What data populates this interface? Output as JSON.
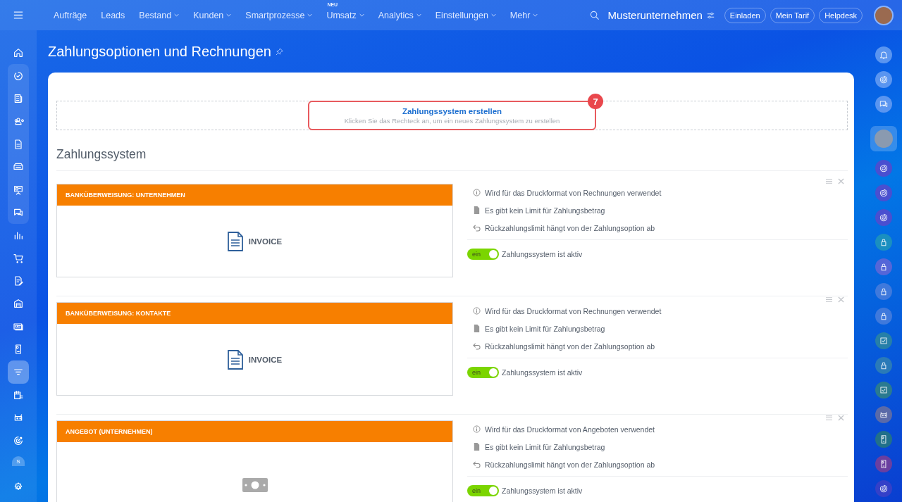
{
  "topnav": {
    "items": [
      {
        "label": "Aufträge",
        "dropdown": false
      },
      {
        "label": "Leads",
        "dropdown": false
      },
      {
        "label": "Bestand",
        "dropdown": true
      },
      {
        "label": "Kunden",
        "dropdown": true
      },
      {
        "label": "Smartprozesse",
        "dropdown": true
      },
      {
        "label": "Umsatz",
        "dropdown": true,
        "badge": "NEU"
      },
      {
        "label": "Analytics",
        "dropdown": true
      },
      {
        "label": "Einstellungen",
        "dropdown": true
      },
      {
        "label": "Mehr",
        "dropdown": true
      }
    ],
    "company": "Musterunternehmen",
    "buttons": [
      "Einladen",
      "Mein Tarif",
      "Helpdesk"
    ]
  },
  "sidebar": {
    "items": [
      {
        "kind": "home",
        "selected": false,
        "grouped": false
      },
      {
        "kind": "tasks",
        "selected": false,
        "grouped": true
      },
      {
        "kind": "news",
        "selected": false,
        "grouped": true
      },
      {
        "kind": "contacts",
        "selected": false,
        "grouped": true
      },
      {
        "kind": "doc",
        "selected": false,
        "grouped": true
      },
      {
        "kind": "inbox",
        "selected": false,
        "grouped": true
      },
      {
        "kind": "board",
        "selected": false,
        "grouped": true
      },
      {
        "kind": "chat",
        "selected": false,
        "grouped": true
      },
      {
        "kind": "chart",
        "selected": false,
        "grouped": false
      },
      {
        "kind": "cart",
        "selected": false,
        "grouped": false
      },
      {
        "kind": "sign",
        "selected": false,
        "grouped": false
      },
      {
        "kind": "store",
        "selected": false,
        "grouped": false
      },
      {
        "kind": "card",
        "selected": false,
        "grouped": false
      },
      {
        "kind": "phone",
        "selected": false,
        "grouped": false
      },
      {
        "kind": "funnel",
        "selected": true,
        "grouped": false
      },
      {
        "kind": "calendar",
        "selected": false,
        "grouped": false
      },
      {
        "kind": "robot",
        "selected": false,
        "grouped": false
      },
      {
        "kind": "target",
        "selected": false,
        "grouped": false
      }
    ],
    "user_initial": "S"
  },
  "page": {
    "title": "Zahlungsoptionen und Rechnungen"
  },
  "create_box": {
    "title": "Zahlungssystem erstellen",
    "hint": "Klicken Sie das Rechteck an, um ein neues Zahlungssystem zu erstellen",
    "marker": "7"
  },
  "section_title": "Zahlungssystem",
  "payment_systems": [
    {
      "title": "BANKÜBERWEISUNG: UNTERNEHMEN",
      "kind": "invoice",
      "logo_label": "INVOICE",
      "info": [
        {
          "kind": "info",
          "text": "Wird für das Druckformat von Rechnungen verwendet"
        },
        {
          "kind": "file",
          "text": "Es gibt kein Limit für Zahlungsbetrag"
        },
        {
          "kind": "refund",
          "text": "Rückzahlungslimit hängt von der Zahlungsoption ab"
        }
      ],
      "switch_label": "ein",
      "on": true,
      "status": "Zahlungssystem ist aktiv"
    },
    {
      "title": "BANKÜBERWEISUNG: KONTAKTE",
      "kind": "invoice",
      "logo_label": "INVOICE",
      "info": [
        {
          "kind": "info",
          "text": "Wird für das Druckformat von Rechnungen verwendet"
        },
        {
          "kind": "file",
          "text": "Es gibt kein Limit für Zahlungsbetrag"
        },
        {
          "kind": "refund",
          "text": "Rückzahlungslimit hängt von der Zahlungsoption ab"
        }
      ],
      "switch_label": "ein",
      "on": true,
      "status": "Zahlungssystem ist aktiv"
    },
    {
      "title": "ANGEBOT (UNTERNEHMEN)",
      "kind": "cash",
      "info": [
        {
          "kind": "info",
          "text": "Wird für das Druckformat von Angeboten verwendet"
        },
        {
          "kind": "file",
          "text": "Es gibt kein Limit für Zahlungsbetrag"
        },
        {
          "kind": "refund",
          "text": "Rückzahlungslimit hängt von der Zahlungsoption ab"
        }
      ],
      "switch_label": "ein",
      "on": true,
      "status": "Zahlungssystem ist aktiv"
    }
  ],
  "right_rail": [
    {
      "kind": "bell",
      "color": "#5a95f0",
      "selected": false
    },
    {
      "kind": "spiral",
      "color": "#5a95f0",
      "selected": false
    },
    {
      "kind": "chat",
      "color": "#5a95f0",
      "selected": false
    },
    {
      "kind": "avatar",
      "color": "#8a9ab0",
      "selected": true
    },
    {
      "kind": "spiral",
      "color": "#4a4fd0",
      "selected": false
    },
    {
      "kind": "spiral",
      "color": "#4a4fd0",
      "selected": false
    },
    {
      "kind": "spiral",
      "color": "#4a4fd0",
      "selected": false
    },
    {
      "kind": "lock",
      "color": "#1a8fc0",
      "selected": false
    },
    {
      "kind": "lock",
      "color": "#5566d8",
      "selected": false
    },
    {
      "kind": "lock",
      "color": "#3f79dc",
      "selected": false
    },
    {
      "kind": "lock",
      "color": "#3f79dc",
      "selected": false
    },
    {
      "kind": "check",
      "color": "#267fa8",
      "selected": false
    },
    {
      "kind": "lock",
      "color": "#2a7ab8",
      "selected": false
    },
    {
      "kind": "check",
      "color": "#2a7a90",
      "selected": false
    },
    {
      "kind": "robot",
      "color": "#5a6aa8",
      "selected": false
    },
    {
      "kind": "phone",
      "color": "#21708a",
      "selected": false
    },
    {
      "kind": "phone",
      "color": "#6a3fa0",
      "selected": false
    },
    {
      "kind": "spiral",
      "color": "#3440c8",
      "selected": false
    }
  ]
}
